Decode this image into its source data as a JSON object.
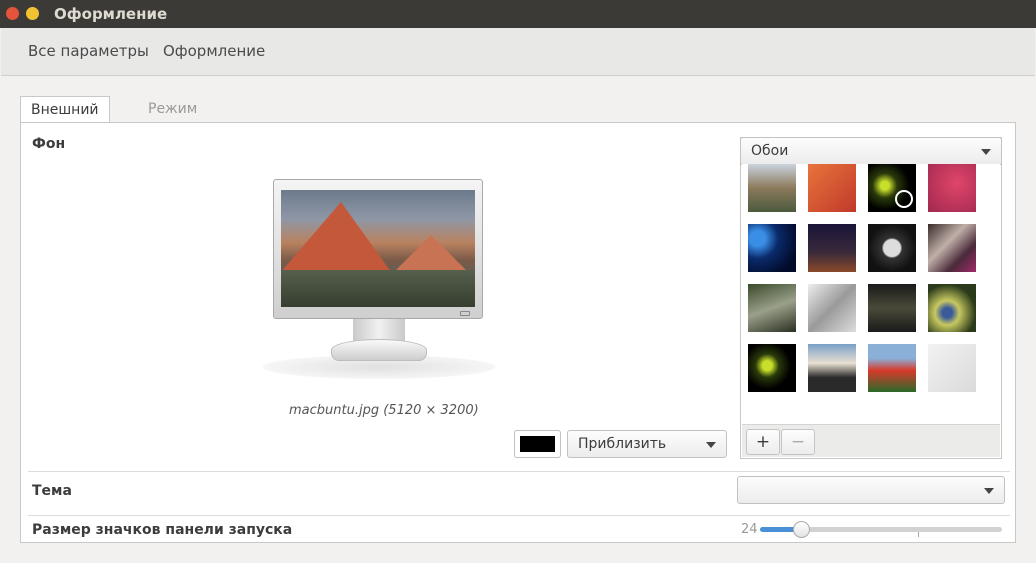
{
  "window": {
    "title": "Оформление"
  },
  "nav": {
    "all_settings": "Все параметры",
    "section": "Оформление"
  },
  "tabs": [
    {
      "label": "Внешний вид"
    },
    {
      "label": "Режим"
    }
  ],
  "background": {
    "label": "Фон",
    "filename_caption": "macbuntu.jpg (5120 × 3200)",
    "color_hex": "#000000",
    "mode_select": "Приблизить",
    "source_select": "Обои",
    "add_icon": "plus-icon",
    "remove_icon": "minus-icon"
  },
  "wallpapers": [
    {
      "name": "wallpaper-mountains"
    },
    {
      "name": "wallpaper-orange"
    },
    {
      "name": "wallpaper-firefly-clock"
    },
    {
      "name": "wallpaper-magenta"
    },
    {
      "name": "wallpaper-planet"
    },
    {
      "name": "wallpaper-stars"
    },
    {
      "name": "wallpaper-pocketwatch"
    },
    {
      "name": "wallpaper-glass"
    },
    {
      "name": "wallpaper-plant"
    },
    {
      "name": "wallpaper-ice"
    },
    {
      "name": "wallpaper-dark-foliage"
    },
    {
      "name": "wallpaper-dragonfly"
    },
    {
      "name": "wallpaper-firefly"
    },
    {
      "name": "wallpaper-sunrise-mist"
    },
    {
      "name": "wallpaper-tulips"
    },
    {
      "name": "wallpaper-grey"
    }
  ],
  "theme": {
    "label": "Тема",
    "select_value": ""
  },
  "launcher_icon_size": {
    "label": "Размер значков панели запуска",
    "value": "24",
    "fraction": 0.17
  },
  "colors": {
    "accent": "#4a90d9",
    "titlebar": "#3b3a36",
    "close": "#e5533a",
    "minimize": "#f1c232"
  }
}
